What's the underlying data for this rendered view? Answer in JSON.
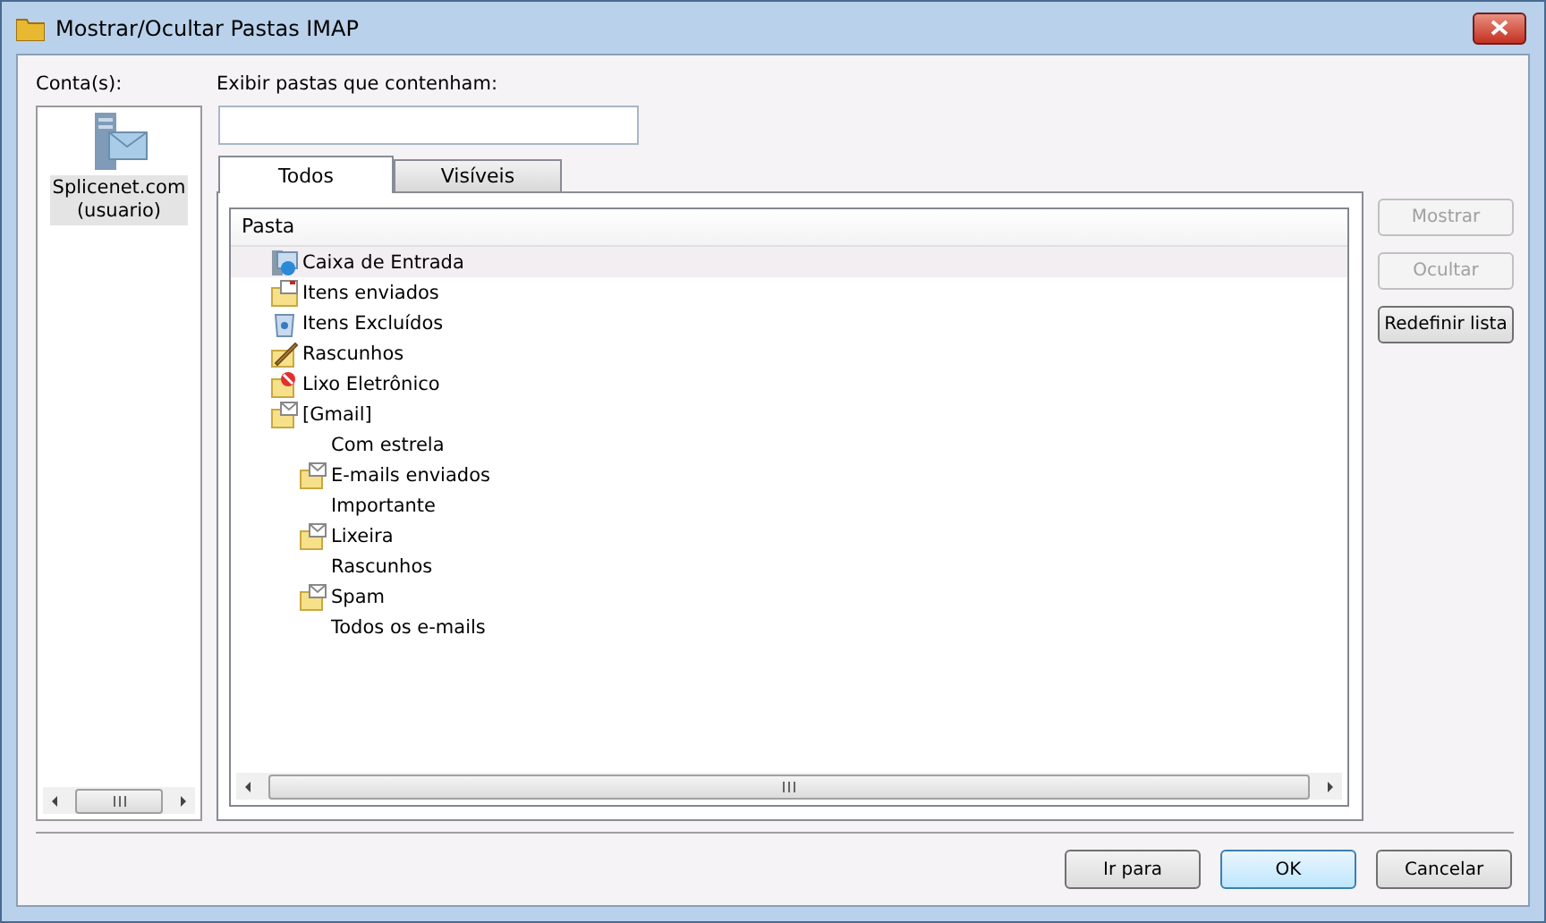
{
  "window": {
    "title": "Mostrar/Ocultar Pastas IMAP"
  },
  "accounts": {
    "label": "Conta(s):",
    "items": [
      {
        "name": "Splicenet.com",
        "detail": "(usuario)",
        "selected": true
      }
    ]
  },
  "filter": {
    "label": "Exibir pastas que contenham:"
  },
  "tabs": [
    {
      "label": "Todos",
      "selected": true
    },
    {
      "label": "Visíveis",
      "selected": false
    }
  ],
  "folder_list": {
    "column": "Pasta",
    "items": [
      {
        "name": "Caixa de Entrada",
        "kind": "inbox",
        "selected": true
      },
      {
        "name": "Itens enviados",
        "kind": "sent",
        "selected": false
      },
      {
        "name": "Itens Excluídos",
        "kind": "deleted",
        "selected": false
      },
      {
        "name": "Rascunhos",
        "kind": "drafts",
        "selected": false
      },
      {
        "name": "Lixo Eletrônico",
        "kind": "junk",
        "selected": false
      },
      {
        "name": "[Gmail]",
        "kind": "mail",
        "selected": false,
        "children": [
          {
            "name": "Com estrela",
            "kind": "none",
            "selected": false
          },
          {
            "name": "E-mails enviados",
            "kind": "mail",
            "selected": false
          },
          {
            "name": "Importante",
            "kind": "none",
            "selected": false
          },
          {
            "name": "Lixeira",
            "kind": "mail",
            "selected": false
          },
          {
            "name": "Rascunhos",
            "kind": "none",
            "selected": false
          },
          {
            "name": "Spam",
            "kind": "mail",
            "selected": false
          },
          {
            "name": "Todos os e-mails",
            "kind": "none",
            "selected": false
          }
        ]
      }
    ]
  },
  "side_buttons": [
    {
      "label": "Mostrar",
      "disabled": true
    },
    {
      "label": "Ocultar",
      "disabled": true
    },
    {
      "label": "Redefinir lista",
      "disabled": false
    }
  ],
  "footer_buttons": [
    {
      "label": "Ir para",
      "default": false
    },
    {
      "label": "OK",
      "default": true
    },
    {
      "label": "Cancelar",
      "default": false
    }
  ]
}
